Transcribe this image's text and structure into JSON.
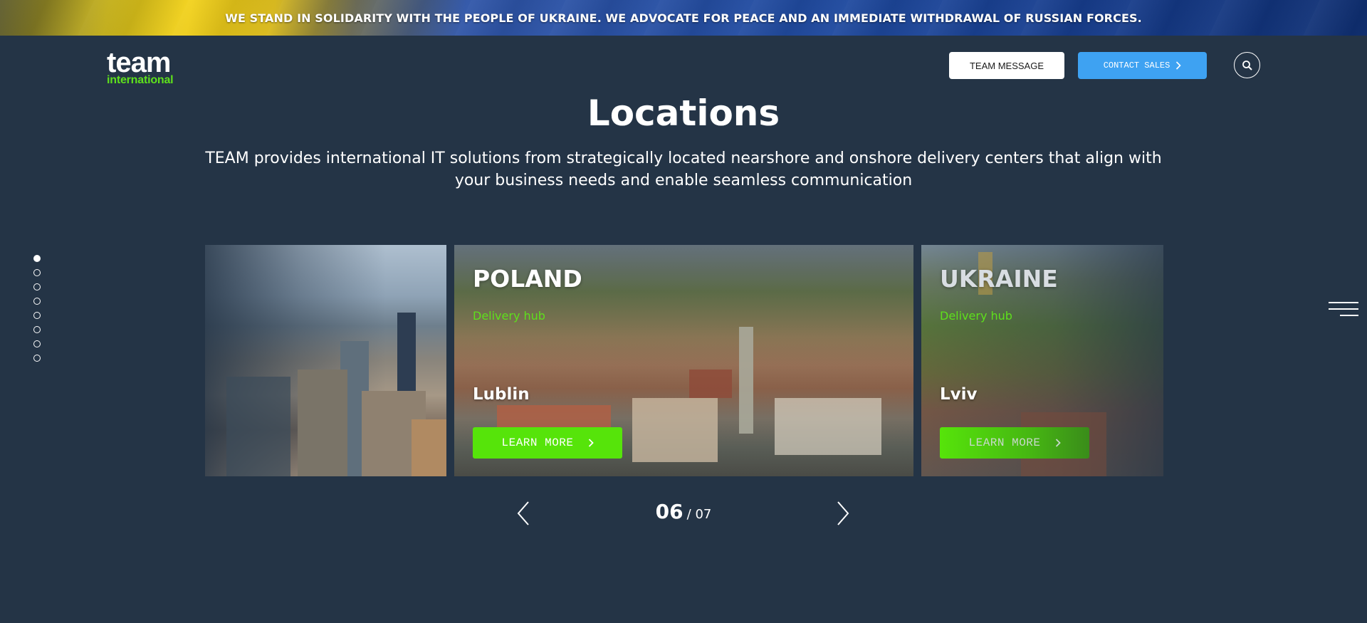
{
  "banner": {
    "text": "WE STAND IN SOLIDARITY WITH THE PEOPLE OF UKRAINE. WE ADVOCATE FOR PEACE AND AN IMMEDIATE WITHDRAWAL OF RUSSIAN FORCES."
  },
  "header": {
    "logo_top": "team",
    "logo_bottom": "international",
    "team_message_label": "TEAM MESSAGE",
    "contact_sales_label": "CONTACT SALES"
  },
  "hero": {
    "title": "Locations",
    "subtitle": "TEAM provides international IT solutions from strategically located nearshore and onshore delivery centers that align with your business needs and enable seamless communication"
  },
  "cards": [
    {
      "country": "POLAND",
      "hub": "Delivery hub",
      "city": "Lublin",
      "button": "LEARN MORE"
    },
    {
      "country": "UKRAINE",
      "hub": "Delivery hub",
      "city": "Lviv",
      "button": "LEARN MORE"
    }
  ],
  "pager": {
    "current": "06",
    "total": "/ 07"
  },
  "side_dots": {
    "count": 8,
    "active_index": 0
  },
  "colors": {
    "background": "#243446",
    "accent_green": "#56e40a",
    "accent_blue": "#3ea2f2"
  },
  "icons": [
    "search-icon",
    "chevron-right-icon",
    "chevron-left-icon",
    "hamburger-menu-icon"
  ]
}
